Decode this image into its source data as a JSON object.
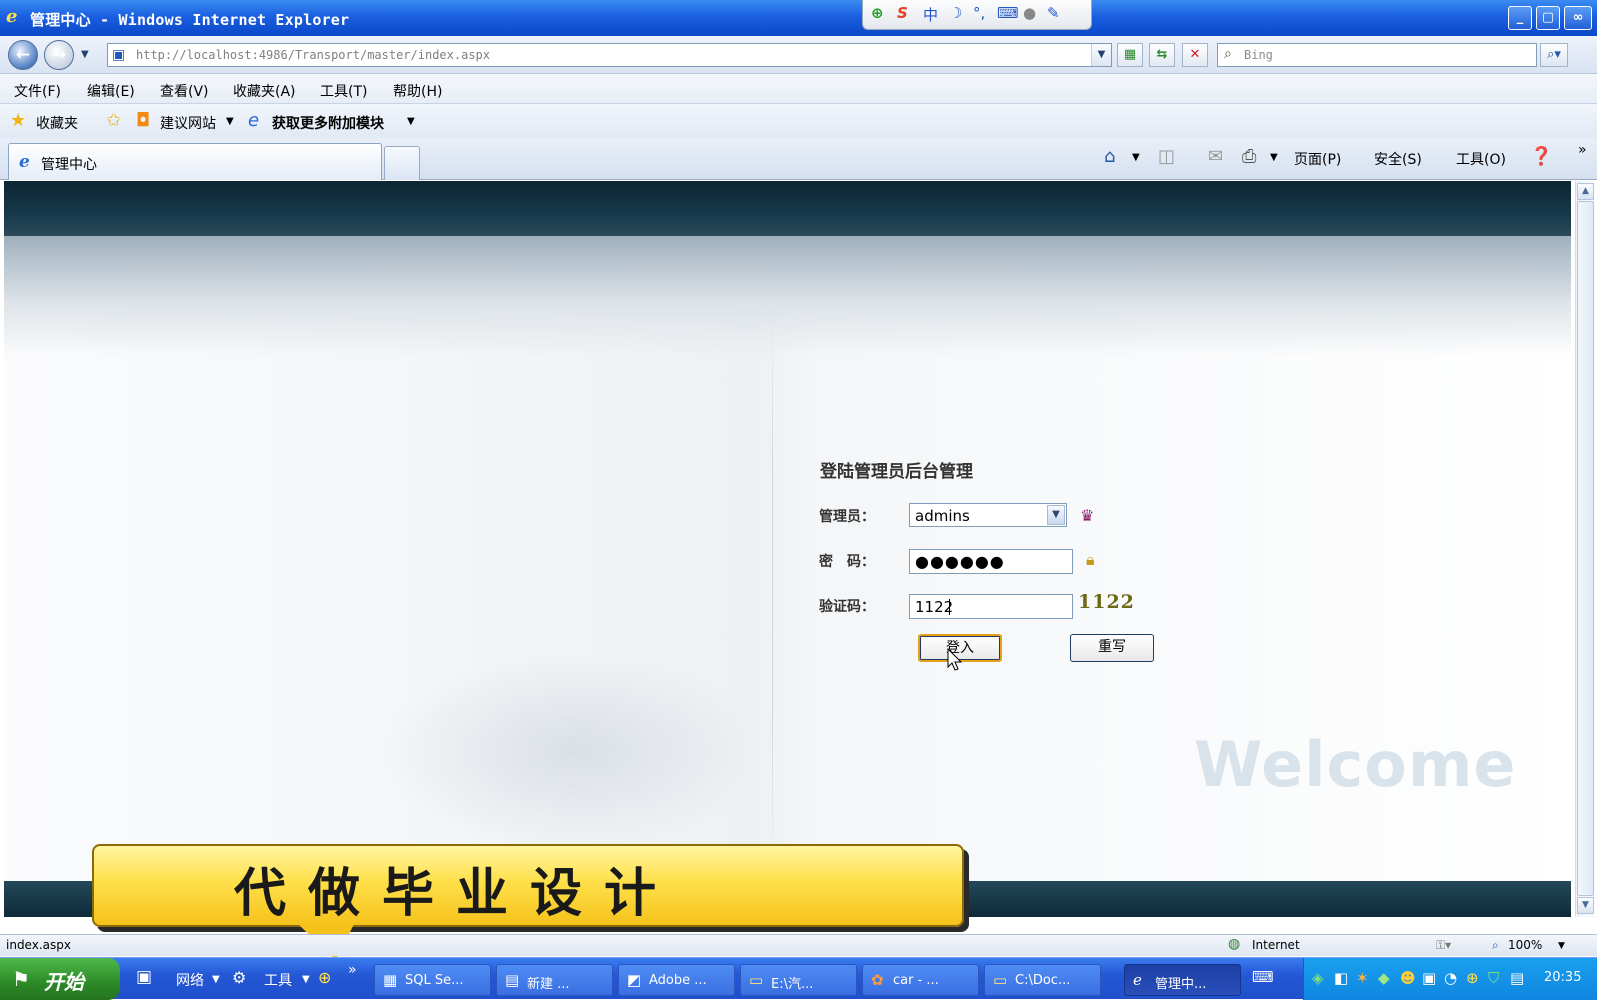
{
  "window": {
    "title": "管理中心 - Windows Internet Explorer",
    "ime": {
      "mode": "中",
      "s_logo": "S"
    }
  },
  "address": {
    "url": "http://localhost:4986/Transport/master/index.aspx",
    "search_placeholder": "Bing"
  },
  "menu": {
    "items": [
      "文件(F)",
      "编辑(E)",
      "查看(V)",
      "收藏夹(A)",
      "工具(T)",
      "帮助(H)"
    ]
  },
  "favorites": {
    "label": "收藏夹",
    "suggested": "建议网站",
    "addons": "获取更多附加模块"
  },
  "tab": {
    "title": "管理中心"
  },
  "commandbar": {
    "page": "页面(P)",
    "safety": "安全(S)",
    "tools": "工具(O)"
  },
  "login": {
    "heading": "登陆管理员后台管理",
    "admin_label": "管理员：",
    "admin_value": "admins",
    "password_label": "密　码：",
    "password_value": "●●●●●●",
    "captcha_label": "验证码：",
    "captcha_input": "1122",
    "captcha_image": "1122",
    "login_button": "登入",
    "reset_button": "重写",
    "welcome": "Welcome"
  },
  "banner": {
    "text": "代做毕业设计"
  },
  "status": {
    "left": "index.aspx",
    "zone": "Internet",
    "zoom": "100%"
  },
  "taskbar": {
    "start": "开始",
    "quick": [
      "网络",
      "工具"
    ],
    "tasks": [
      "SQL Se...",
      "新建 ...",
      "Adobe ...",
      "E:\\汽...",
      "car - ...",
      "C:\\Doc...",
      "管理中..."
    ],
    "clock": "20:35"
  },
  "colors": {
    "title_bar": "#1b5fe0",
    "banner": "#ffe04a",
    "captcha": "#6b6a14",
    "taskbar": "#2558d6"
  }
}
